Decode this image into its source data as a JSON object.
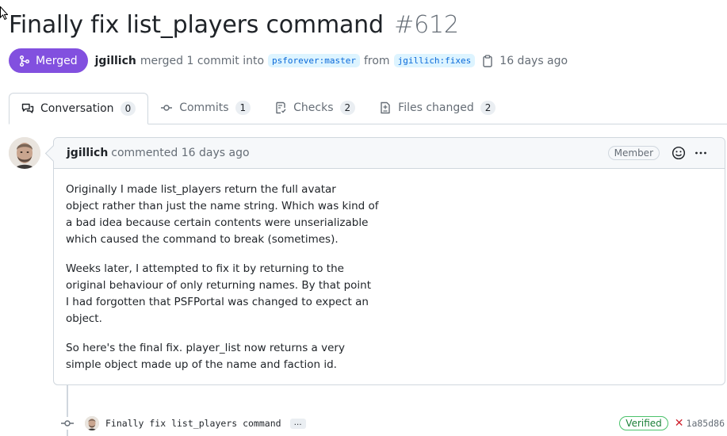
{
  "pr": {
    "title": "Finally fix list_players command",
    "number": "#612",
    "state": "Merged",
    "author": "jgillich",
    "action": "merged 1 commit into",
    "base_branch": "psforever:master",
    "from_label": "from",
    "head_branch": "jgillich:fixes",
    "time_ago": "16 days ago"
  },
  "tabs": [
    {
      "label": "Conversation",
      "count": "0",
      "icon": "comment-discussion-icon"
    },
    {
      "label": "Commits",
      "count": "1",
      "icon": "git-commit-icon"
    },
    {
      "label": "Checks",
      "count": "2",
      "icon": "checklist-icon"
    },
    {
      "label": "Files changed",
      "count": "2",
      "icon": "file-diff-icon"
    }
  ],
  "comment": {
    "author": "jgillich",
    "action": "commented 16 days ago",
    "role": "Member",
    "paragraphs": [
      [
        "Originally I made list_players return the full avatar",
        "object rather than just the name string. Which was kind of",
        "a bad idea because certain contents were unserializable",
        "which caused the command to break (sometimes)."
      ],
      [
        "Weeks later, I attempted to fix it by returning to the",
        "original behaviour of only returning names. By that point",
        "I had forgotten that PSFPortal was changed to expect an",
        "object."
      ],
      [
        "So here's the final fix. player_list now returns a very",
        "simple object made up of the name and faction id."
      ]
    ]
  },
  "commit": {
    "message": "Finally fix list_players command",
    "ellipsis": "…",
    "verified": "Verified",
    "status_icon": "x-icon",
    "sha": "1a85d86"
  },
  "colors": {
    "merged": "#8250df",
    "link": "#0969da",
    "branch_bg": "#ddf4ff",
    "verified": "#1a7f37",
    "failure": "#cf222e"
  }
}
